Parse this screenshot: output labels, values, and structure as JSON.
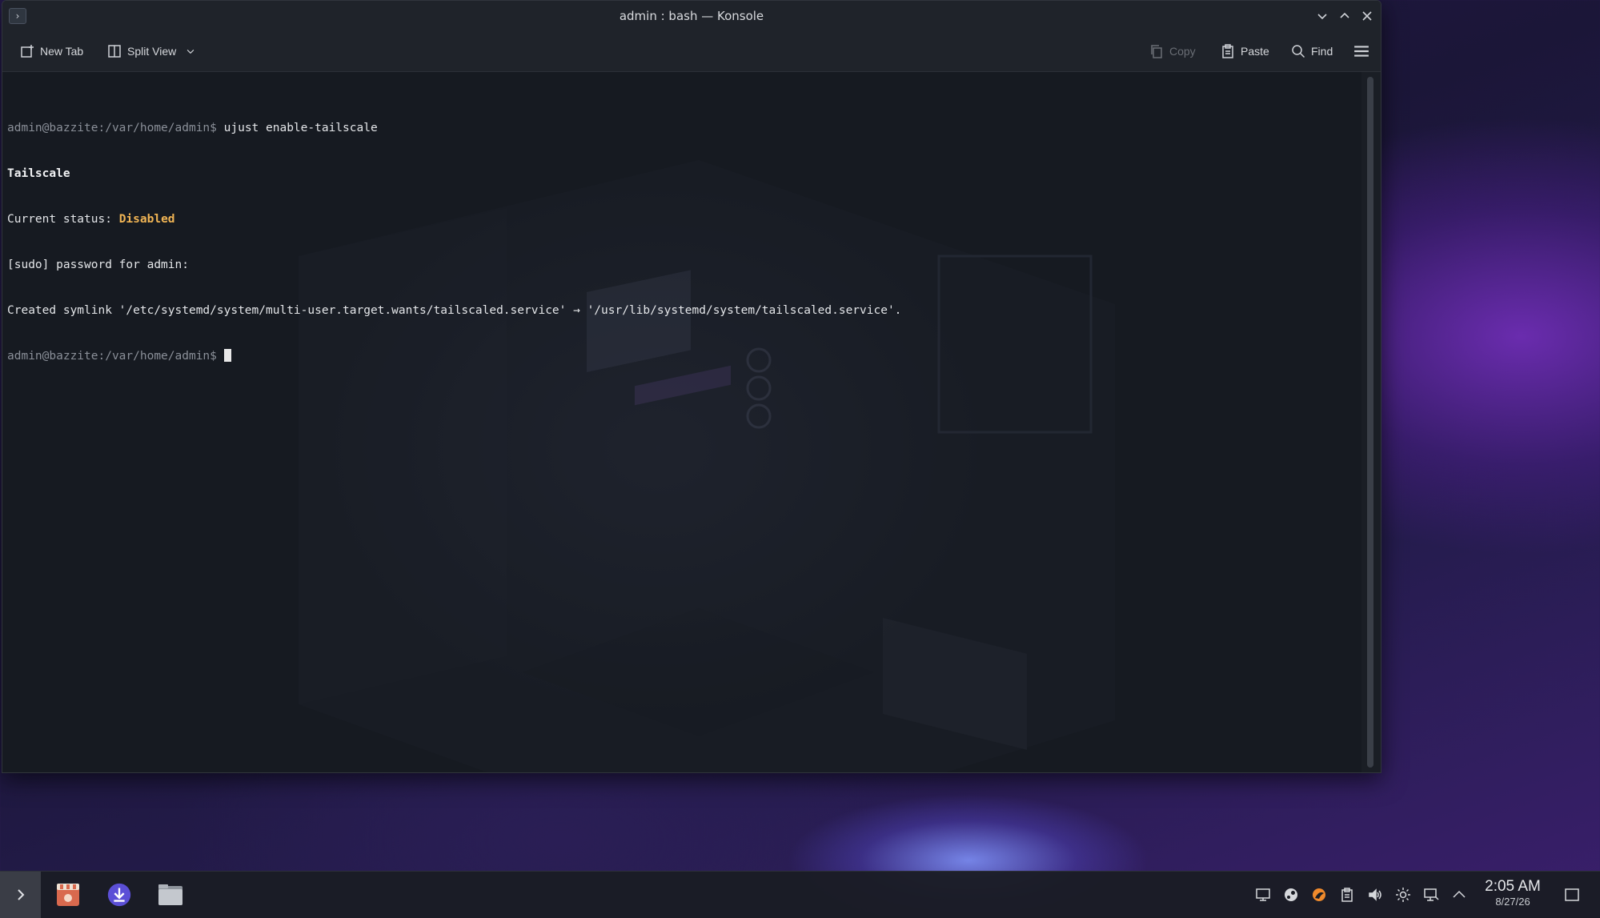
{
  "window": {
    "title": "admin : bash — Konsole"
  },
  "toolbar": {
    "new_tab": "New Tab",
    "split_view": "Split View",
    "copy": "Copy",
    "paste": "Paste",
    "find": "Find"
  },
  "terminal": {
    "prompt": "admin@bazzite:/var/home/admin$",
    "command": " ujust enable-tailscale",
    "line2": "Tailscale",
    "status_label": "Current status: ",
    "status_value": "Disabled",
    "sudo_line": "[sudo] password for admin:",
    "symlink_line": "Created symlink '/etc/systemd/system/multi-user.target.wants/tailscaled.service' → '/usr/lib/systemd/system/tailscaled.service'.",
    "prompt2": "admin@bazzite:/var/home/admin$",
    "prompt2_tail": " "
  },
  "taskbar": {
    "time": "2:05 AM",
    "date": "8/27/26",
    "apps": [
      "start-icon",
      "store-icon",
      "download-icon",
      "file-manager-icon"
    ],
    "tray_icons": [
      "display-icon",
      "steam-icon",
      "firefox-icon",
      "clipboard-icon",
      "volume-icon",
      "brightness-icon",
      "network-icon",
      "chevron-up-icon"
    ]
  },
  "colors": {
    "terminal_bg": "#161a21",
    "status_disabled": "#f0b454",
    "accent_purple": "#6a2cae"
  }
}
